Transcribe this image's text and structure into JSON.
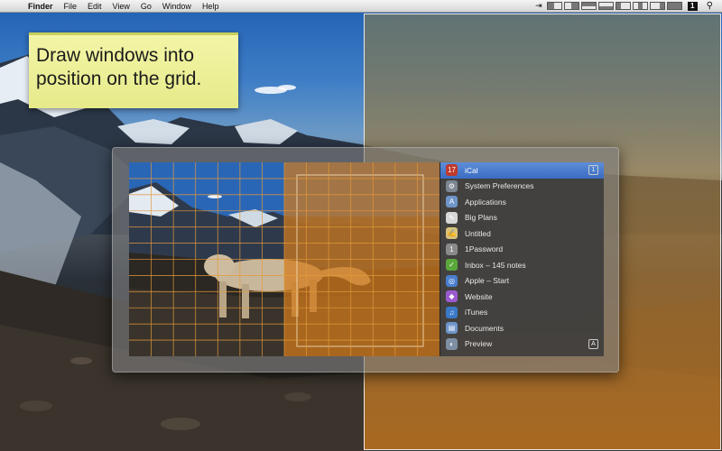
{
  "menubar": {
    "apple_icon": "apple-logo-icon",
    "app_name": "Finder",
    "menus": [
      "File",
      "Edit",
      "View",
      "Go",
      "Window",
      "Help"
    ],
    "status_badge": "1"
  },
  "hint": {
    "line1": "Draw windows into",
    "line2": "position on the grid."
  },
  "window_list": {
    "items": [
      {
        "label": "iCal",
        "icon": "ical-icon",
        "color": "#c0392b",
        "selected": true,
        "shortcut": "1"
      },
      {
        "label": "System Preferences",
        "icon": "system-preferences-icon",
        "color": "#7d8793"
      },
      {
        "label": "Applications",
        "icon": "applications-folder-icon",
        "color": "#6f95c8"
      },
      {
        "label": "Big Plans",
        "icon": "big-plans-icon",
        "color": "#d7d7d7"
      },
      {
        "label": "Untitled",
        "icon": "textedit-icon",
        "color": "#d9c27a"
      },
      {
        "label": "1Password",
        "icon": "1password-icon",
        "color": "#8a8a8a"
      },
      {
        "label": "Inbox – 145 notes",
        "icon": "evernote-icon",
        "color": "#5aa83c"
      },
      {
        "label": "Apple – Start",
        "icon": "safari-icon",
        "color": "#4a7fcf"
      },
      {
        "label": "Website",
        "icon": "website-icon",
        "color": "#9b59d0"
      },
      {
        "label": "iTunes",
        "icon": "itunes-icon",
        "color": "#3a78c8"
      },
      {
        "label": "Documents",
        "icon": "documents-folder-icon",
        "color": "#6f95c8"
      },
      {
        "label": "Preview",
        "icon": "preview-icon",
        "color": "#7e8ea3",
        "shortcut": "A"
      }
    ]
  },
  "colors": {
    "selection": "#3a6cc2",
    "grid_line": "#e39a3a",
    "overlay_orange": "#c8781e"
  }
}
